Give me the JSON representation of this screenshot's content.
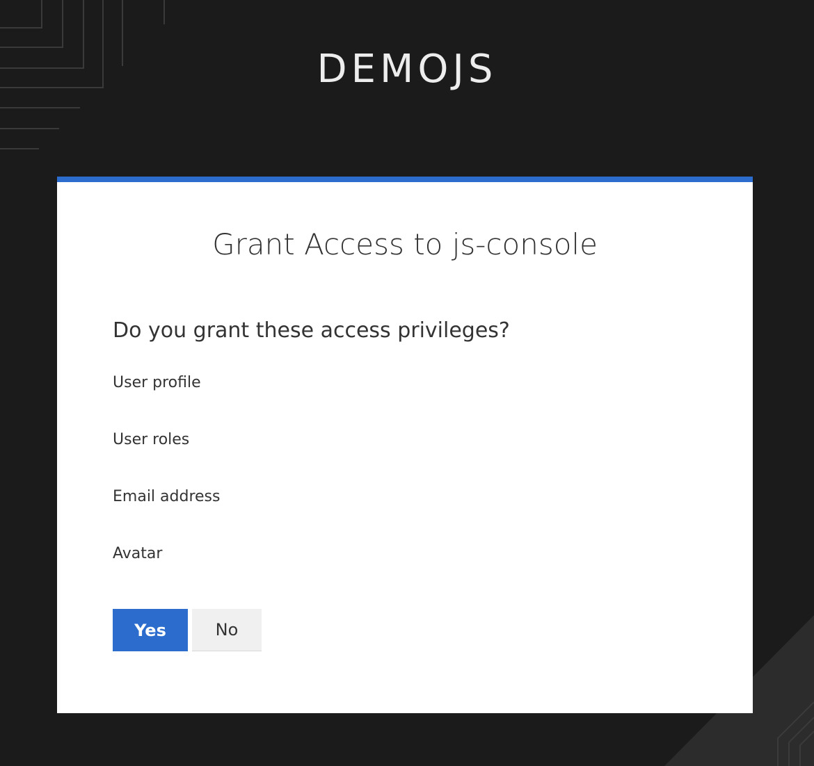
{
  "brand": {
    "title": "DEMOJS"
  },
  "consent": {
    "title": "Grant Access to js-console",
    "question": "Do you grant these access privileges?",
    "privileges": [
      "User profile",
      "User roles",
      "Email address",
      "Avatar"
    ],
    "yes_label": "Yes",
    "no_label": "No"
  },
  "colors": {
    "accent": "#2b6ccd",
    "background": "#1b1b1b",
    "card": "#ffffff"
  }
}
